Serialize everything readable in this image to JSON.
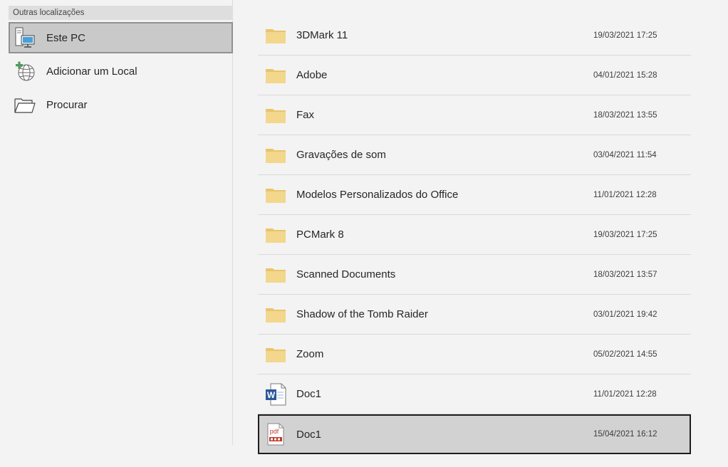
{
  "sidebar": {
    "section_title": "Outras localizações",
    "places": [
      {
        "label": "Este PC",
        "icon": "computer-icon",
        "selected": true
      },
      {
        "label": "Adicionar um Local",
        "icon": "add-place-globe-icon",
        "selected": false
      },
      {
        "label": "Procurar",
        "icon": "open-folder-icon",
        "selected": false
      }
    ]
  },
  "files": [
    {
      "name": "3DMark 11",
      "modified": "19/03/2021 17:25",
      "type": "folder"
    },
    {
      "name": "Adobe",
      "modified": "04/01/2021 15:28",
      "type": "folder"
    },
    {
      "name": "Fax",
      "modified": "18/03/2021 13:55",
      "type": "folder"
    },
    {
      "name": "Gravações de som",
      "modified": "03/04/2021 11:54",
      "type": "folder"
    },
    {
      "name": "Modelos Personalizados do Office",
      "modified": "11/01/2021 12:28",
      "type": "folder"
    },
    {
      "name": "PCMark 8",
      "modified": "19/03/2021 17:25",
      "type": "folder"
    },
    {
      "name": "Scanned Documents",
      "modified": "18/03/2021 13:57",
      "type": "folder"
    },
    {
      "name": "Shadow of the Tomb Raider",
      "modified": "03/01/2021 19:42",
      "type": "folder"
    },
    {
      "name": "Zoom",
      "modified": "05/02/2021 14:55",
      "type": "folder"
    },
    {
      "name": "Doc1",
      "modified": "11/01/2021 12:28",
      "type": "word"
    },
    {
      "name": "Doc1",
      "modified": "15/04/2021 16:12",
      "type": "pdf",
      "selected": true
    }
  ],
  "icons": {
    "pdf_glyph": "pdf",
    "word_glyph": "W"
  },
  "colors": {
    "folder": "#f2d78c",
    "word_blue": "#2b579a",
    "pdf_red": "#c0392b",
    "selection_bg": "#d2d2d2"
  }
}
